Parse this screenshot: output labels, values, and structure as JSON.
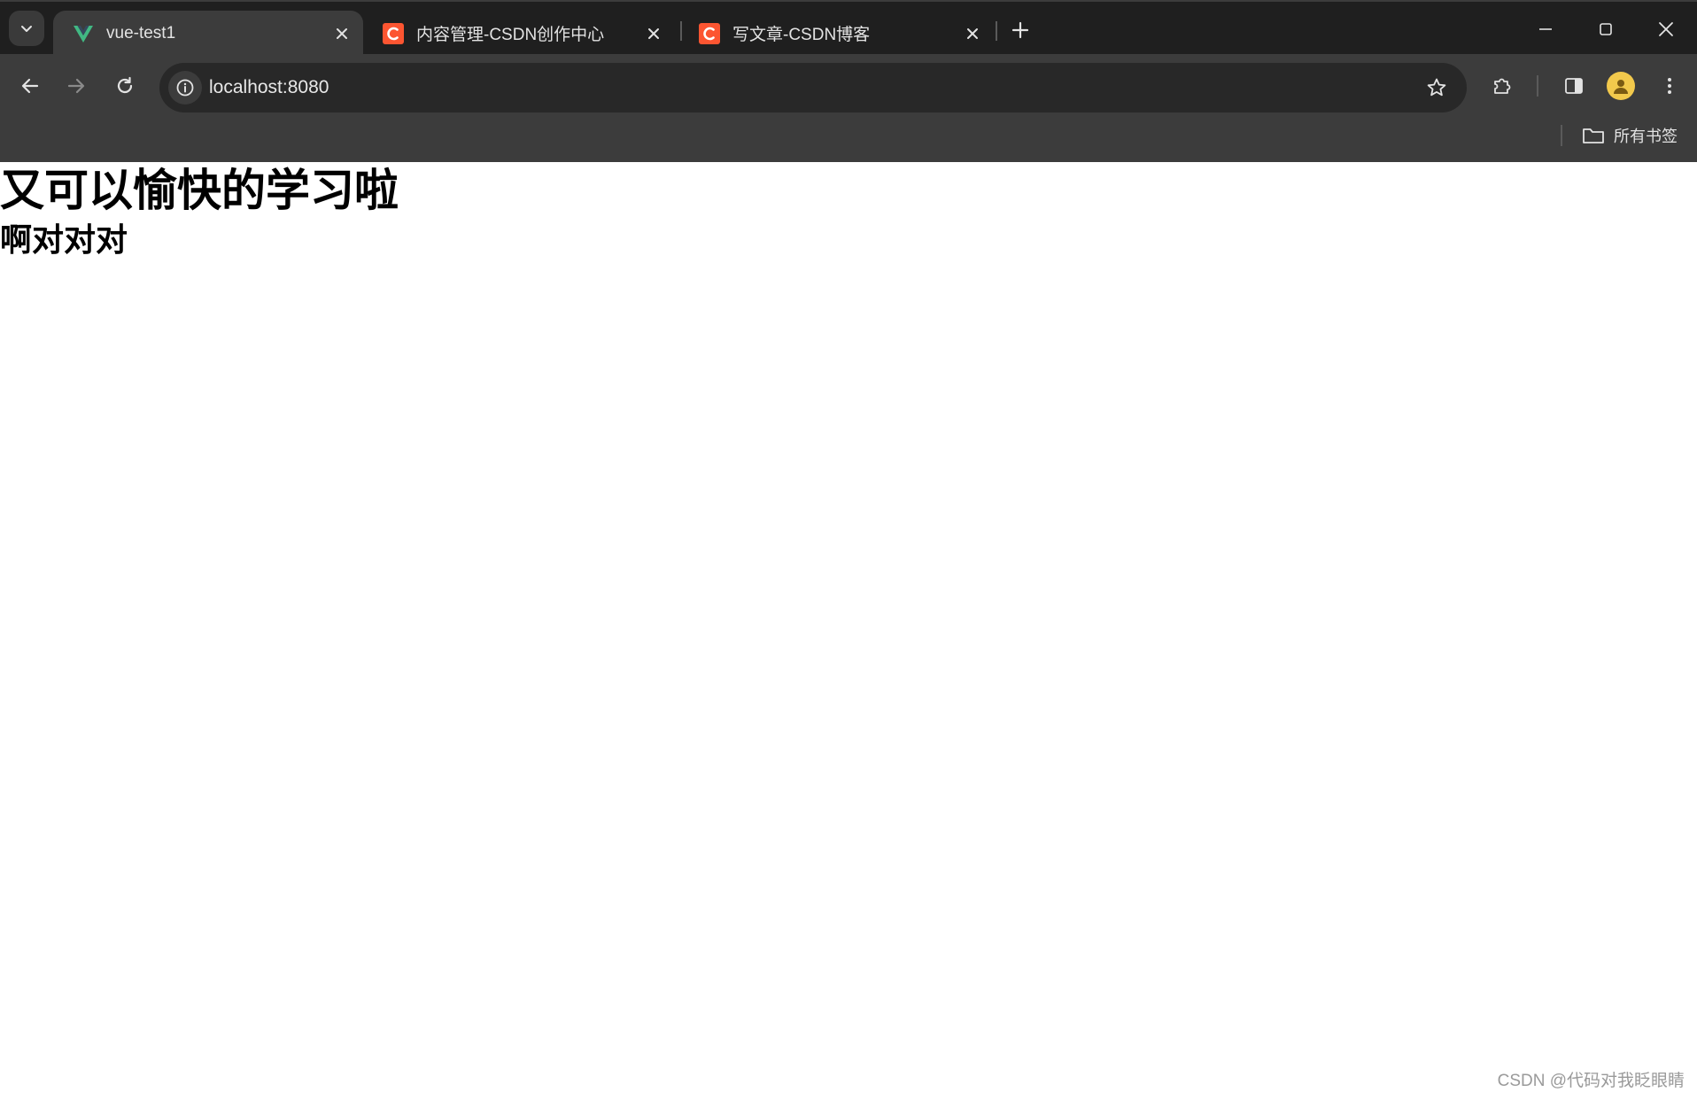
{
  "browser": {
    "tabs": [
      {
        "title": "vue-test1",
        "active": true,
        "favicon": "vue-logo-icon"
      },
      {
        "title": "内容管理-CSDN创作中心",
        "active": false,
        "favicon": "csdn-logo-icon"
      },
      {
        "title": "写文章-CSDN博客",
        "active": false,
        "favicon": "csdn-logo-icon"
      }
    ],
    "address": {
      "url": "localhost:8080"
    },
    "bookmarks_bar": {
      "all_bookmarks_label": "所有书签"
    },
    "colors": {
      "frame": "#1f1f1f",
      "toolbar": "#3c3c3c",
      "omnibox": "#282828",
      "vue_green": "#41b883",
      "csdn_red": "#fc5531"
    }
  },
  "page": {
    "heading": "又可以愉快的学习啦",
    "subheading": "啊对对对",
    "watermark": "CSDN @代码对我眨眼睛"
  }
}
